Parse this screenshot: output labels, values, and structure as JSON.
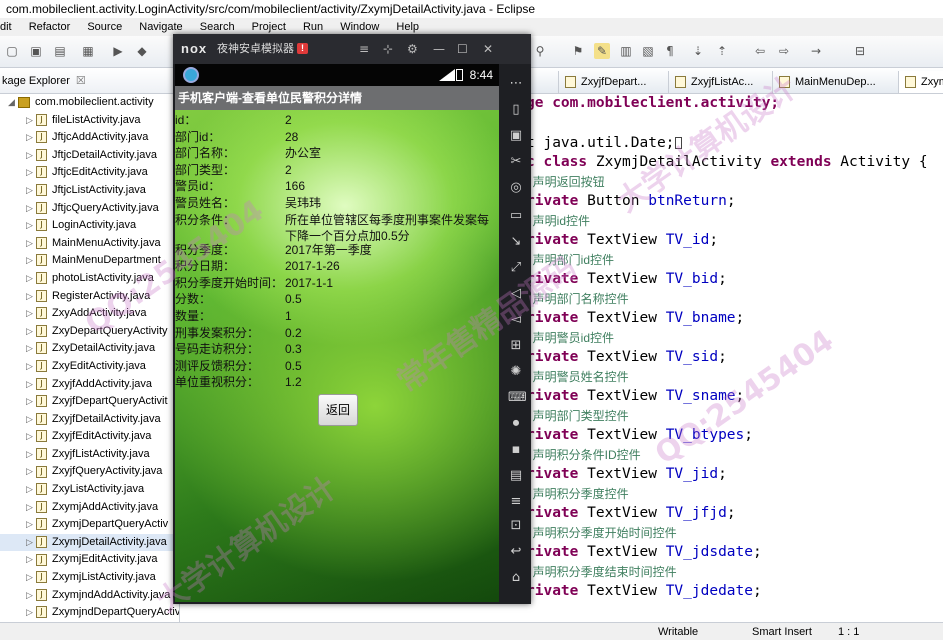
{
  "window": {
    "title": "com.mobileclient.activity.LoginActivity/src/com/mobileclient/activity/ZxymjDetailActivity.java - Eclipse"
  },
  "menu": [
    "dit",
    "Refactor",
    "Source",
    "Navigate",
    "Search",
    "Project",
    "Run",
    "Window",
    "Help"
  ],
  "package_explorer": {
    "title": "kage Explorer",
    "close": "☒",
    "root": "com.mobileclient.activity",
    "files": [
      "fileListActivity.java",
      "JftjcAddActivity.java",
      "JftjcDetailActivity.java",
      "JftjcEditActivity.java",
      "JftjcListActivity.java",
      "JftjcQueryActivity.java",
      "LoginActivity.java",
      "MainMenuActivity.java",
      "MainMenuDepartment",
      "photoListActivity.java",
      "RegisterActivity.java",
      "ZxyAddActivity.java",
      "ZxyDepartQueryActivity",
      "ZxyDetailActivity.java",
      "ZxyEditActivity.java",
      "ZxyjfAddActivity.java",
      "ZxyjfDepartQueryActivit",
      "ZxyjfDetailActivity.java",
      "ZxyjfEditActivity.java",
      "ZxyjfListActivity.java",
      "ZxyjfQueryActivity.java",
      "ZxyListActivity.java",
      "ZxymjAddActivity.java",
      "ZxymjDepartQueryActiv",
      "ZxymjDetailActivity.java",
      "ZxymjEditActivity.java",
      "ZxymjListActivity.java",
      "ZxymjndAddActivity.java",
      "ZxymjndDepartQueryActivity.java"
    ],
    "selected_index": 24
  },
  "editor": {
    "tabs": [
      "ZxyjfDepart...",
      "ZxyjfListAc...",
      "MainMenuDep...",
      "Zxym"
    ],
    "active_tab": 3,
    "code": {
      "l1_pre": "ge com.mobileclient.activity;",
      "l2": "t java.util.Date;",
      "l3_kw1": "c class",
      "l3_cls": " ZxymjDetailActivity ",
      "l3_kw2": "extends",
      "l3_rest": " Activity {",
      "c1": "声明返回按钮",
      "f1_kw": "rivate",
      "f1_type": " Button ",
      "f1_name": "btnReturn",
      "c2": "声明id控件",
      "f2_name": "TV_id",
      "c3": "声明部门id控件",
      "f3_name": "TV_bid",
      "c4": "声明部门名称控件",
      "f4_name": "TV_bname",
      "c5": "声明警员id控件",
      "f5_name": "TV_sid",
      "c6": "声明警员姓名控件",
      "f6_name": "TV_sname",
      "c7": "声明部门类型控件",
      "f7_name": "TV_btypes",
      "c8": "声明积分条件ID控件",
      "f8_name": "TV_jid",
      "c9": "声明积分季度控件",
      "f9_name": "TV_jfjd",
      "c10": "声明积分季度开始时间控件",
      "f10_name": "TV_jdsdate",
      "c11": "声明积分季度结束时间控件",
      "f11_name": "TV_jdedate",
      "tv_type": " TextView ",
      "semicolon": ";",
      "comment_prefix": "/ "
    }
  },
  "statusbar": {
    "writable": "Writable",
    "insert": "Smart Insert",
    "pos": "1 : 1"
  },
  "emulator": {
    "logo": "nox",
    "name": "夜神安卓模拟器",
    "warn": "!",
    "time": "8:44",
    "app_title": "手机客户端-查看单位民警积分详情",
    "fields": [
      {
        "label": "id：",
        "value": "2"
      },
      {
        "label": "部门id：",
        "value": "28"
      },
      {
        "label": "部门名称：",
        "value": "办公室"
      },
      {
        "label": "部门类型：",
        "value": "2"
      },
      {
        "label": "警员id：",
        "value": "166"
      },
      {
        "label": "警员姓名：",
        "value": "吴玮玮"
      },
      {
        "label": "积分条件：",
        "value": "所在单位管辖区每季度刑事案件发案每下降一个百分点加0.5分"
      },
      {
        "label": "积分季度：",
        "value": "2017年第一季度"
      },
      {
        "label": "积分日期：",
        "value": "2017-1-26"
      },
      {
        "label": "积分季度开始时间：",
        "value": "2017-1-1"
      },
      {
        "label": "分数：",
        "value": "0.5"
      },
      {
        "label": "数量：",
        "value": "1"
      },
      {
        "label": "刑事发案积分：",
        "value": "0.2"
      },
      {
        "label": "号码走访积分：",
        "value": "0.3"
      },
      {
        "label": "测评反馈积分：",
        "value": "0.5"
      },
      {
        "label": "单位重视积分：",
        "value": "1.2"
      }
    ],
    "back_button": "返回"
  },
  "watermark": {
    "qq": "QQ:2545404",
    "shop": "常年售精品源码",
    "design": "大学计算机设计"
  }
}
